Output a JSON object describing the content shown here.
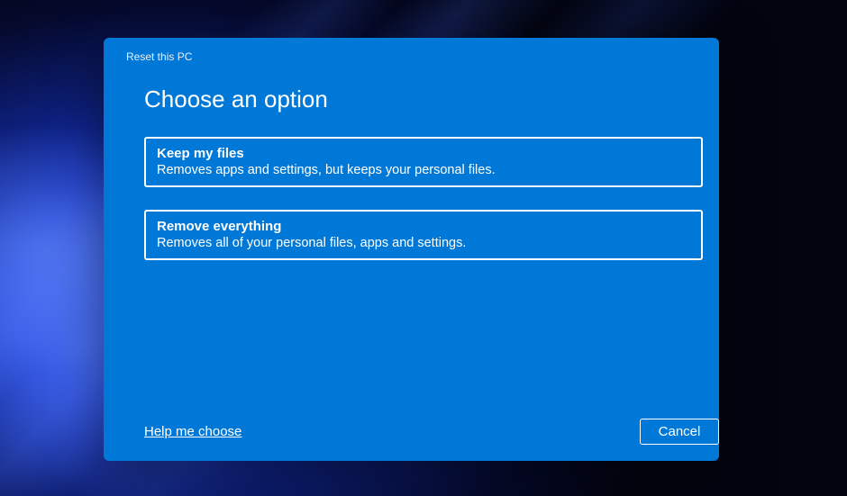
{
  "dialog": {
    "titlebar": "Reset this PC",
    "heading": "Choose an option",
    "options": [
      {
        "title": "Keep my files",
        "desc": "Removes apps and settings, but keeps your personal files."
      },
      {
        "title": "Remove everything",
        "desc": "Removes all of your personal files, apps and settings."
      }
    ],
    "help_link": "Help me choose",
    "cancel": "Cancel"
  }
}
